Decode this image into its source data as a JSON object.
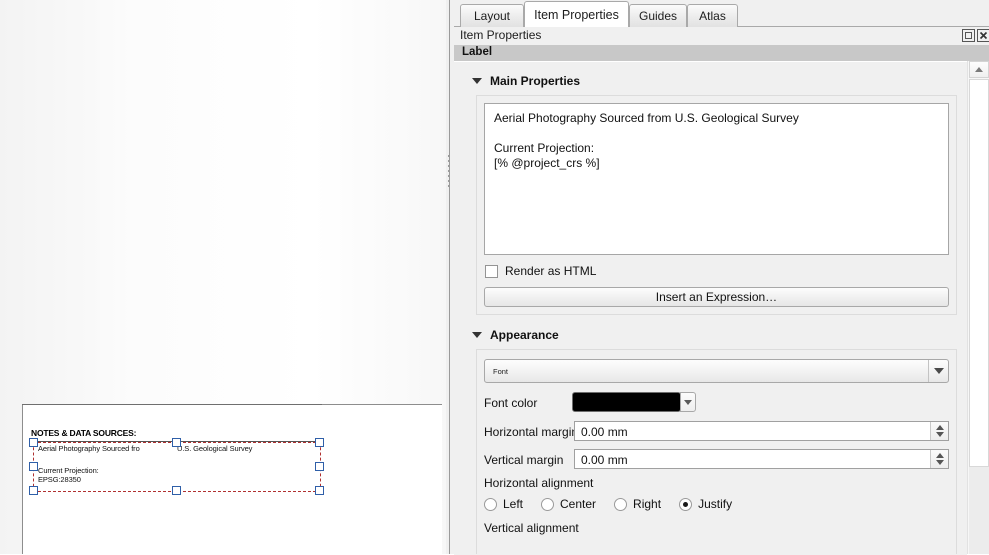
{
  "canvas": {
    "notes_item": {
      "title": "NOTES & DATA SOURCES:",
      "line1": "Aerial Photography Sourced fro",
      "line1b": "U.S. Geological Survey",
      "line2": "Current Projection:",
      "line3": "EPSG:28350"
    }
  },
  "dock": {
    "tabs": [
      {
        "label": "Layout",
        "active": false
      },
      {
        "label": "Item Properties",
        "active": true
      },
      {
        "label": "Guides",
        "active": false
      },
      {
        "label": "Atlas",
        "active": false
      }
    ],
    "title": "Item Properties",
    "float_icon": "float-icon",
    "close_icon": "close-icon",
    "group_label": "Label"
  },
  "main_properties": {
    "header": "Main Properties",
    "text_value": "Aerial Photography Sourced from U.S. Geological Survey\n\nCurrent Projection:\n[% @project_crs %]",
    "render_html_label": "Render as HTML",
    "render_html_checked": false,
    "insert_expression_label": "Insert an Expression…"
  },
  "appearance": {
    "header": "Appearance",
    "font_combo_value": "Font",
    "font_color_label": "Font color",
    "font_color_value": "#000000",
    "horizontal_margin_label": "Horizontal margin",
    "horizontal_margin_value": "0.00 mm",
    "vertical_margin_label": "Vertical margin",
    "vertical_margin_value": "0.00 mm",
    "horizontal_alignment_label": "Horizontal alignment",
    "horizontal_alignment_options": [
      {
        "label": "Left",
        "selected": false
      },
      {
        "label": "Center",
        "selected": false
      },
      {
        "label": "Right",
        "selected": false
      },
      {
        "label": "Justify",
        "selected": true
      }
    ],
    "vertical_alignment_label": "Vertical alignment"
  }
}
